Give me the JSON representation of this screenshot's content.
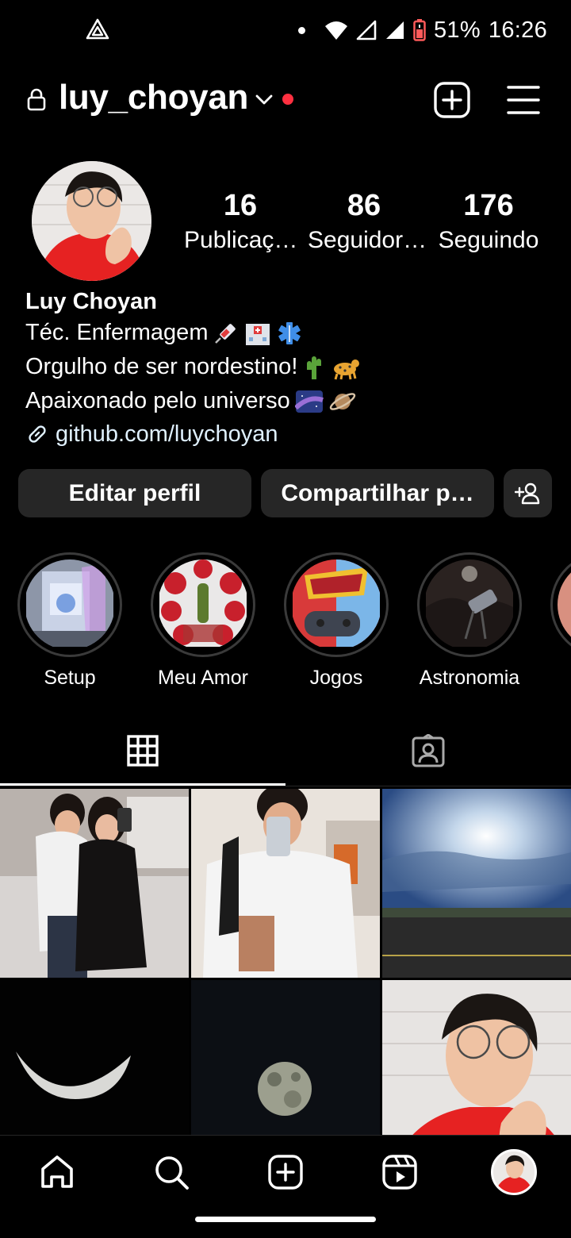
{
  "status_bar": {
    "battery_percent": "51%",
    "time": "16:26",
    "icons": [
      "app-notification-icon",
      "dot-icon",
      "wifi-icon",
      "signal-icon",
      "signal-icon",
      "battery-icon"
    ]
  },
  "header": {
    "username": "luy_choyan",
    "icons": [
      "lock-icon",
      "chevron-down-icon",
      "new-post-icon",
      "menu-icon"
    ],
    "notification_color": "#ff3040"
  },
  "stats": [
    {
      "count": "16",
      "label": "Publicaç…"
    },
    {
      "count": "86",
      "label": "Seguidor…"
    },
    {
      "count": "176",
      "label": "Seguindo"
    }
  ],
  "bio": {
    "name": "Luy Choyan",
    "line1": "Téc. Enfermagem",
    "line2": "Orgulho de ser nordestino!",
    "line3": "Apaixonado pelo universo",
    "link": "github.com/luychoyan"
  },
  "buttons": {
    "edit": "Editar perfil",
    "share": "Compartilhar p…"
  },
  "highlights": [
    {
      "label": "Setup"
    },
    {
      "label": "Meu Amor"
    },
    {
      "label": "Jogos"
    },
    {
      "label": "Astronomia"
    }
  ],
  "tabs": [
    "grid-icon",
    "tagged-icon"
  ],
  "bottom_nav": [
    "home-icon",
    "search-icon",
    "create-icon",
    "reels-icon",
    "profile-avatar"
  ]
}
